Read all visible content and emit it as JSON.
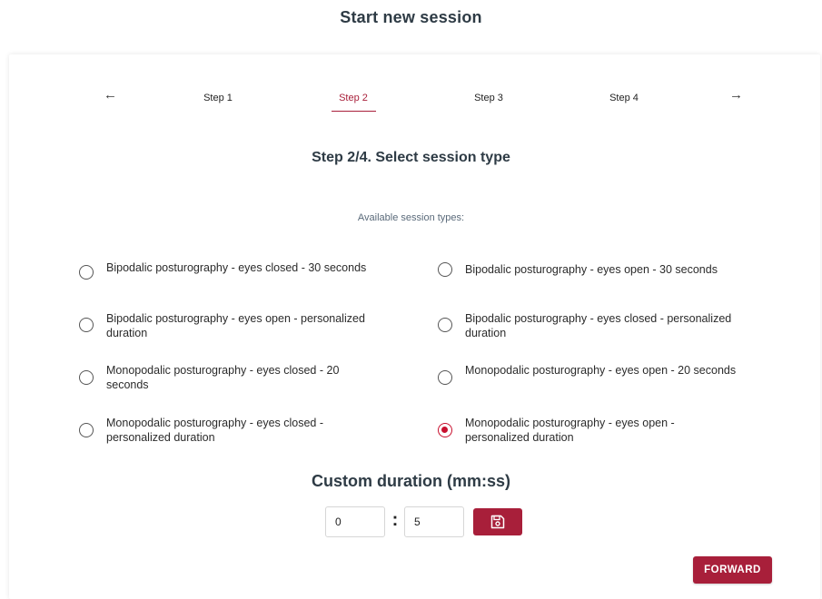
{
  "page": {
    "title": "Start new session"
  },
  "stepper": {
    "prev_icon": "arrow-left-icon",
    "next_icon": "arrow-right-icon",
    "prev_glyph": "←",
    "next_glyph": "→",
    "steps": [
      "Step 1",
      "Step 2",
      "Step 3",
      "Step 4"
    ],
    "active_index": 1
  },
  "step_heading": "Step 2/4. Select session type",
  "types_label": "Available session types:",
  "session_types": [
    {
      "label": "Bipodalic posturography - eyes closed - 30 seconds",
      "checked": false
    },
    {
      "label": "Bipodalic posturography - eyes open - 30 seconds",
      "checked": false
    },
    {
      "label": "Bipodalic posturography - eyes open - personalized duration",
      "checked": false
    },
    {
      "label": "Bipodalic posturography - eyes closed - personalized duration",
      "checked": false
    },
    {
      "label": "Monopodalic posturography - eyes closed - 20 seconds",
      "checked": false
    },
    {
      "label": "Monopodalic posturography - eyes open - 20 seconds",
      "checked": false
    },
    {
      "label": "Monopodalic posturography - eyes closed - personalized duration",
      "checked": false
    },
    {
      "label": "Monopodalic posturography - eyes open - personalized duration",
      "checked": true
    }
  ],
  "custom_duration": {
    "heading": "Custom duration (mm:ss)",
    "minutes": "0",
    "seconds": "5",
    "separator": ":",
    "save_icon": "floppy-disk-icon"
  },
  "forward_label": "FORWARD",
  "colors": {
    "accent": "#a81f3a",
    "radio_checked": "#c8102e",
    "heading": "#2e3b45"
  }
}
